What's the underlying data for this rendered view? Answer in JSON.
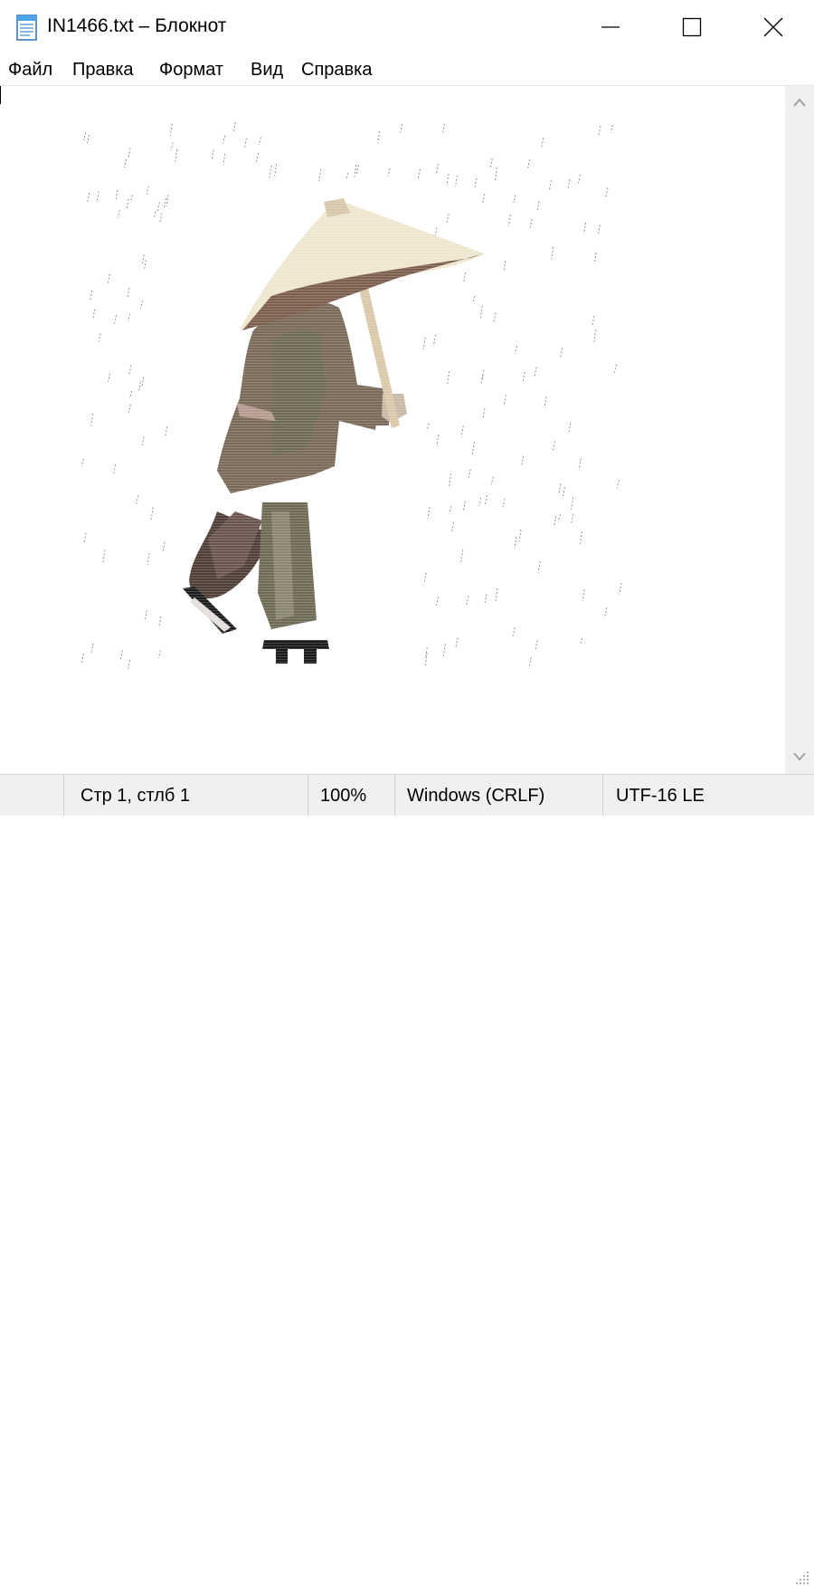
{
  "window": {
    "title": "IN1466.txt – Блокнот",
    "icon": "notepad-icon"
  },
  "menu": {
    "items": [
      {
        "label": "Файл"
      },
      {
        "label": "Правка"
      },
      {
        "label": "Формат"
      },
      {
        "label": "Вид"
      },
      {
        "label": "Справка"
      }
    ]
  },
  "statusbar": {
    "position": "Стр 1, стлб 1",
    "zoom": "100%",
    "line_ending": "Windows (CRLF)",
    "encoding": "UTF-16 LE"
  },
  "colors": {
    "hat": "#efe6cf",
    "robe": "#7a6a5a",
    "robe_shadow": "#4f3f37",
    "pants": "#6e6a55",
    "rain": "#8a8a8a"
  }
}
